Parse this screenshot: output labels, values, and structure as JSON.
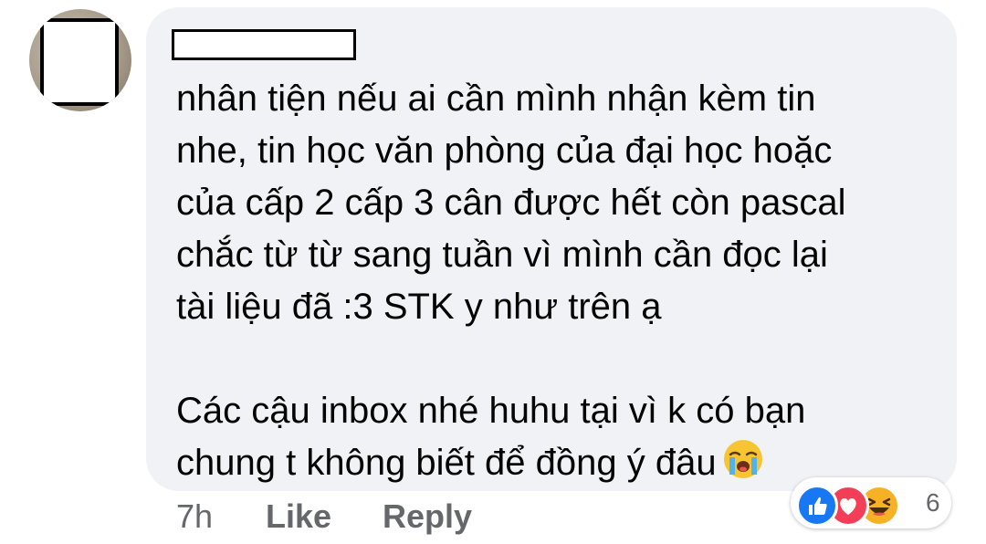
{
  "comment": {
    "author_name_redacted": true,
    "text_lines": [
      "nhân tiện nếu ai cần mình nhận kèm tin",
      "nhe, tin học văn phòng của đại học hoặc",
      "của cấp 2 cấp 3 cân được hết còn pascal",
      "chắc từ từ sang tuần vì mình cần đọc lại",
      "tài liệu đã :3 STK y như trên ạ"
    ],
    "text_lines_2": [
      "Các cậu inbox nhé huhu tại vì k có bạn",
      "chung t không biết để đồng ý đâu"
    ],
    "trailing_emoji": "loudly-crying-face-icon"
  },
  "actions": {
    "time": "7h",
    "like_label": "Like",
    "reply_label": "Reply"
  },
  "reactions": {
    "icons": [
      "like-reaction-icon",
      "love-reaction-icon",
      "haha-reaction-icon"
    ],
    "count": "6"
  },
  "colors": {
    "bubble_bg": "#f0f2f5",
    "meta_text": "#65676b",
    "like_blue": "#1877f2",
    "love_red": "#f33e58",
    "haha_yellow": "#f7b125"
  }
}
